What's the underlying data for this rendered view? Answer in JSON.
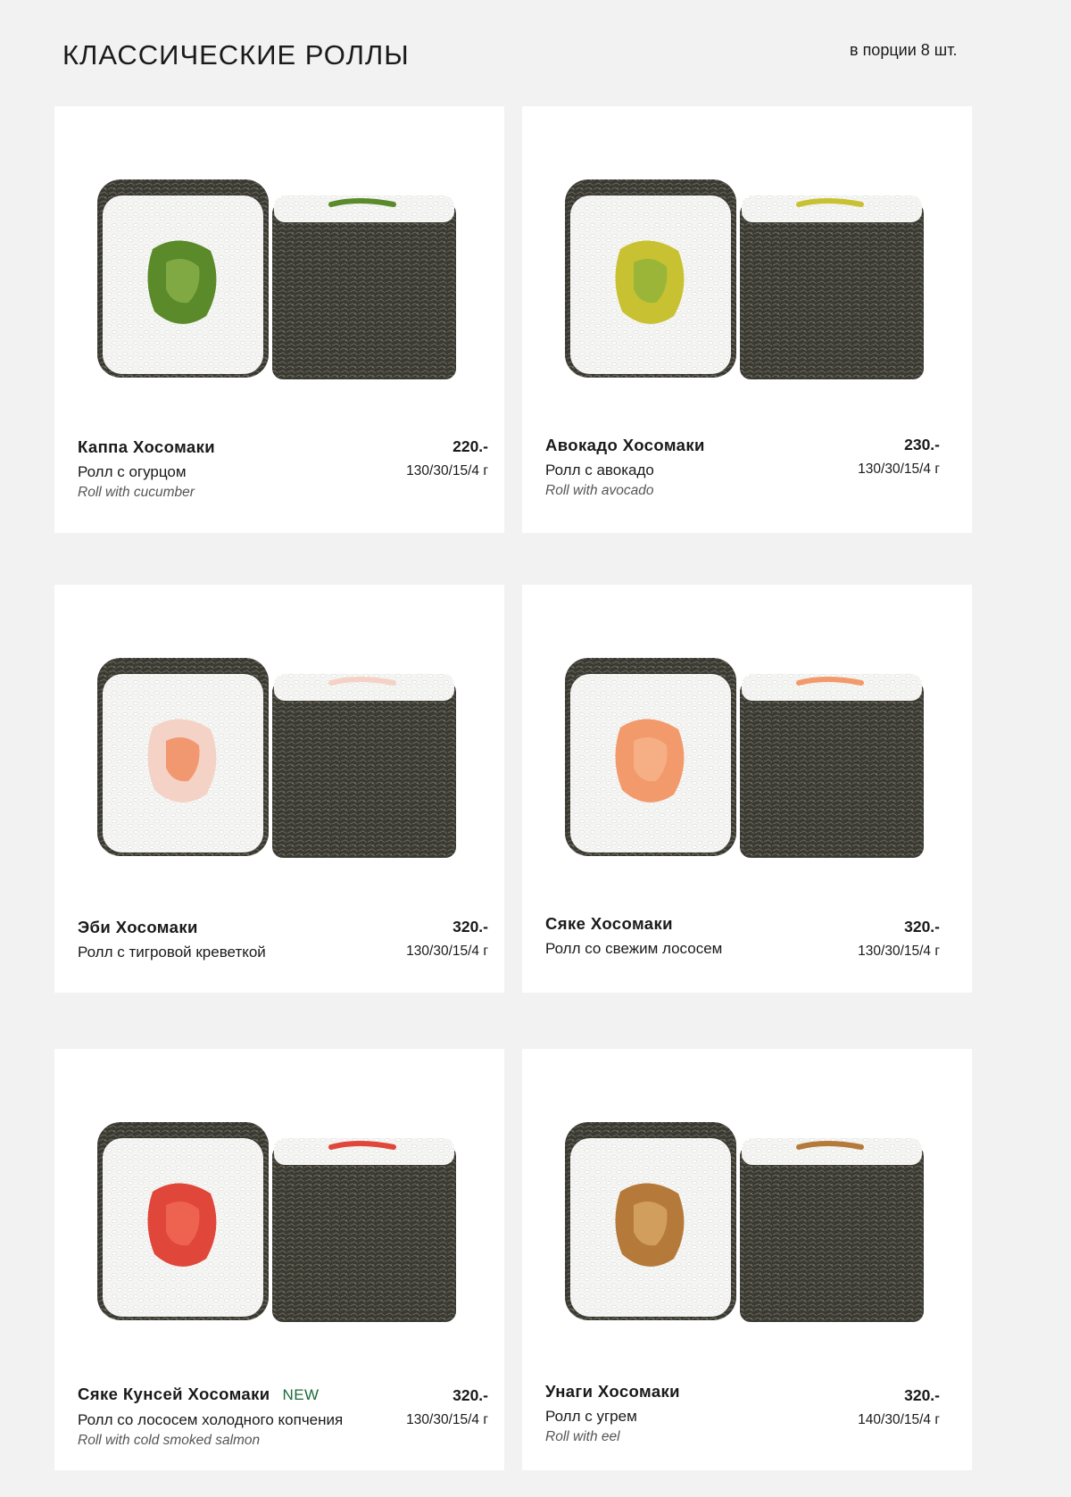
{
  "header": {
    "title": "КЛАССИЧЕСКИЕ РОЛЛЫ",
    "portion_note": "в порции 8 шт."
  },
  "items": [
    {
      "name": "Каппа Хосомаки",
      "desc_ru": "Ролл с огурцом",
      "desc_en": "Roll with cucumber",
      "price": "220.-",
      "weight": "130/30/15/4 г",
      "filling_color": "#5a8a2a",
      "filling_accent": "#8bb04a"
    },
    {
      "name": "Авокадо Хосомаки",
      "desc_ru": "Ролл с авокадо",
      "desc_en": "Roll with avocado",
      "price": "230.-",
      "weight": "130/30/15/4 г",
      "filling_color": "#c8c232",
      "filling_accent": "#8fb23a"
    },
    {
      "name": "Эби Хосомаки",
      "desc_ru": "Ролл с тигровой креветкой",
      "price": "320.-",
      "weight": "130/30/15/4 г",
      "filling_color": "#f4d2c6",
      "filling_accent": "#f08a5a"
    },
    {
      "name": "Сяке Хосомаки",
      "desc_ru": "Ролл со свежим лососем",
      "price": "320.-",
      "weight": "130/30/15/4 г",
      "filling_color": "#f29a6c",
      "filling_accent": "#f6b48c"
    },
    {
      "name": "Сяке Кунсей Хосомаки",
      "badge": "NEW",
      "desc_ru": "Ролл со лососем холодного копчения",
      "desc_en": "Roll with cold smoked salmon",
      "price": "320.-",
      "weight": "130/30/15/4 г",
      "filling_color": "#e0463a",
      "filling_accent": "#f06a55"
    },
    {
      "name": "Унаги Хосомаки",
      "desc_ru": "Ролл с угрем",
      "desc_en": "Roll with eel",
      "price": "320.-",
      "weight": "140/30/15/4 г",
      "filling_color": "#b57a3a",
      "filling_accent": "#d8a868"
    }
  ]
}
